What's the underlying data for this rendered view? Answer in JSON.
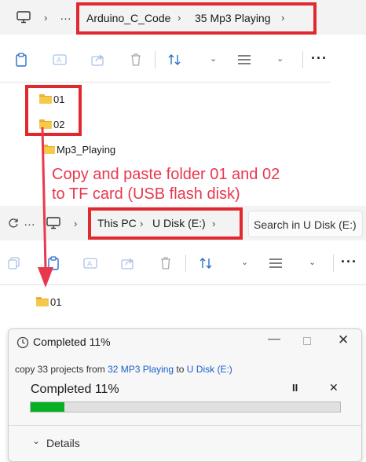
{
  "top_window": {
    "breadcrumb": [
      "Arduino_C_Code",
      "35 Mp3 Playing"
    ],
    "items": [
      {
        "name": "01",
        "highlighted": true
      },
      {
        "name": "02",
        "highlighted": true
      },
      {
        "name": "Mp3_Playing",
        "highlighted": false
      }
    ]
  },
  "annotation": {
    "line1": "Copy and paste folder 01 and 02",
    "line2": "to TF card (USB flash disk)"
  },
  "bottom_window": {
    "breadcrumb": [
      "This PC",
      "U Disk (E:)"
    ],
    "search_placeholder": "Search in U Disk (E:)",
    "items": [
      {
        "name": "01"
      }
    ]
  },
  "dialog": {
    "title": "Completed 11%",
    "copy_prefix": "copy 33 projects from ",
    "source": "32 MP3 Playing",
    "copy_middle": " to ",
    "destination": "U Disk (E:)",
    "status": "Completed 11%",
    "progress": 0.11,
    "details_label": "Details"
  },
  "colors": {
    "highlight_red": "#e0282e",
    "annotation_red": "#e8384e",
    "progress_green": "#06b025",
    "link_blue": "#1a5fc8"
  }
}
